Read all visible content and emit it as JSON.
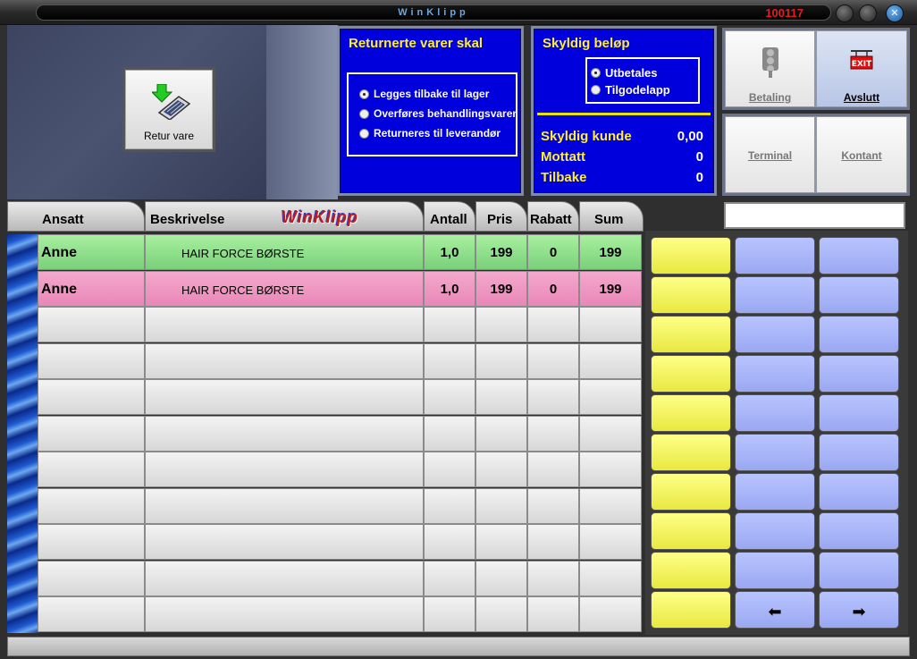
{
  "window": {
    "title": "WinKlipp",
    "code": "100117"
  },
  "retur": {
    "label": "Retur vare"
  },
  "returnert": {
    "header": "Returnerte varer skal",
    "options": [
      {
        "label": "Legges tilbake til lager",
        "selected": true
      },
      {
        "label": "Overføres behandlingsvarer",
        "selected": false
      },
      {
        "label": "Returneres til leverandør",
        "selected": false
      }
    ]
  },
  "skyldig": {
    "header": "Skyldig beløp",
    "options": [
      {
        "label": "Utbetales",
        "selected": true
      },
      {
        "label": "Tilgodelapp",
        "selected": false
      }
    ],
    "rows": [
      {
        "label": "Skyldig kunde",
        "value": "0,00"
      },
      {
        "label": "Mottatt",
        "value": "0"
      },
      {
        "label": "Tilbake",
        "value": "0"
      }
    ]
  },
  "actions": {
    "betaling": "Betaling",
    "avslutt": "Avslutt",
    "terminal": "Terminal",
    "kontant": "Kontant"
  },
  "search": {
    "value": ""
  },
  "table": {
    "logo": "WinKlipp",
    "columns": [
      "Ansatt",
      "Beskrivelse",
      "Antall",
      "Pris",
      "Rabatt",
      "Sum"
    ],
    "rows": [
      {
        "employee": "Anne",
        "description": "HAIR FORCE BØRSTE",
        "qty": "1,0",
        "price": "199",
        "discount": "0",
        "sum": "199",
        "status": "green"
      },
      {
        "employee": "Anne",
        "description": "HAIR FORCE BØRSTE",
        "qty": "1,0",
        "price": "199",
        "discount": "0",
        "sum": "199",
        "status": "pink"
      }
    ]
  },
  "keypad": {
    "left_arrow": "⬅",
    "right_arrow": "➡",
    "colors": {
      "yellow": "#ffff66",
      "blue": "#aab8fa"
    }
  }
}
